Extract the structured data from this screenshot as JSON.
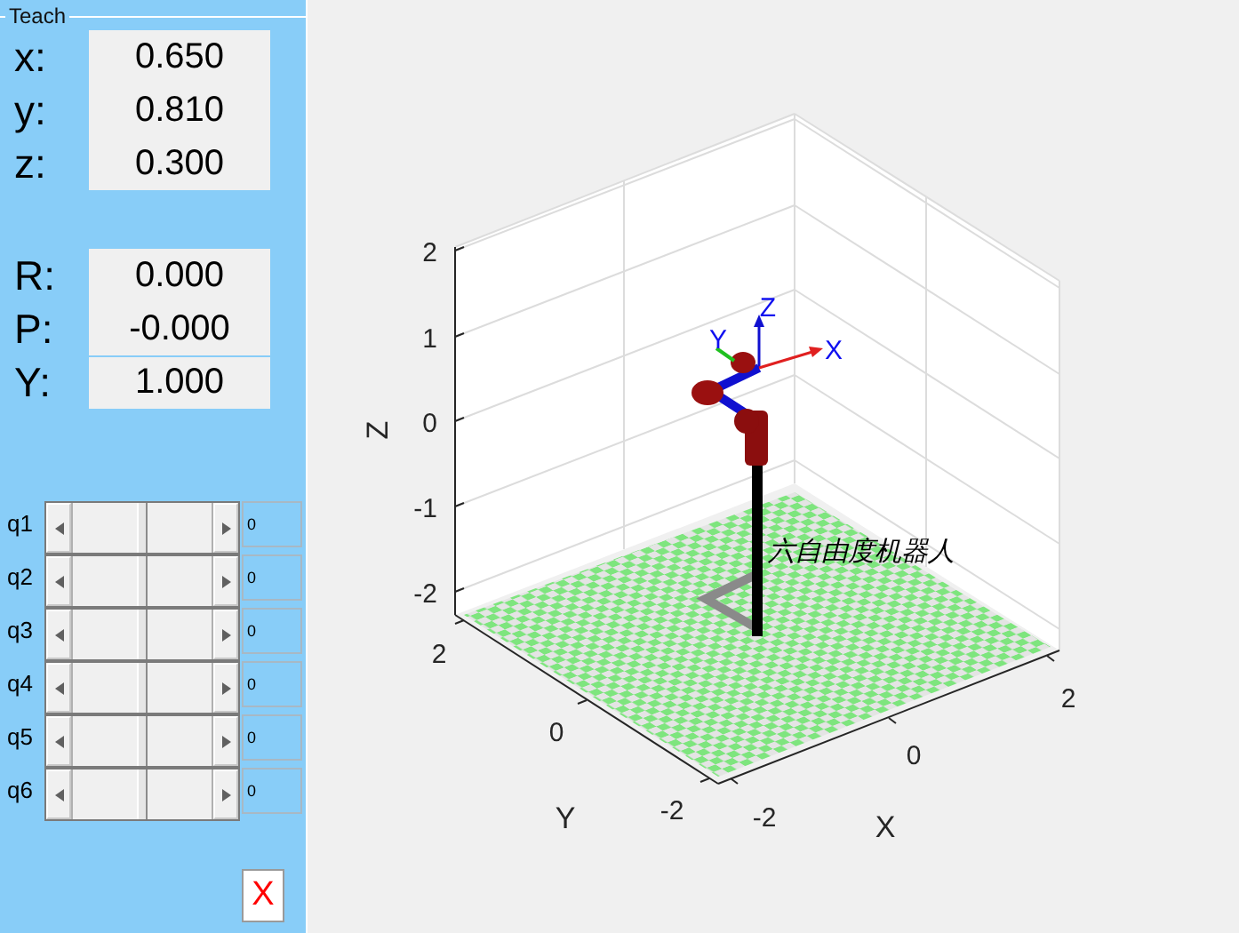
{
  "panel": {
    "title": "Teach"
  },
  "position": [
    {
      "label": "x:",
      "value": "0.650"
    },
    {
      "label": "y:",
      "value": "0.810"
    },
    {
      "label": "z:",
      "value": "0.300"
    }
  ],
  "orientation": [
    {
      "label": "R:",
      "value": "0.000"
    },
    {
      "label": "P:",
      "value": "-0.000"
    },
    {
      "label": "Y:",
      "value": "1.000"
    }
  ],
  "joints": [
    {
      "label": "q1",
      "level": 0.5,
      "value": "0"
    },
    {
      "label": "q2",
      "level": 0.5,
      "value": "0"
    },
    {
      "label": "q3",
      "level": 0.5,
      "value": "0"
    },
    {
      "label": "q4",
      "level": 0.5,
      "value": "0"
    },
    {
      "label": "q5",
      "level": 0.5,
      "value": "0"
    },
    {
      "label": "q6",
      "level": 0.5,
      "value": "0"
    }
  ],
  "close_button": {
    "label": "X"
  },
  "plot": {
    "zlabel": "Z",
    "ylabel": "Y",
    "xlabel": "X",
    "zticks": [
      "2",
      "1",
      "0",
      "-1",
      "-2"
    ],
    "yticks": [
      "2",
      "0",
      "-2"
    ],
    "xticks": [
      "-2",
      "0",
      "2"
    ],
    "frame_labels": [
      "X",
      "Y",
      "Z"
    ],
    "annotation": "六自由度机器人"
  }
}
